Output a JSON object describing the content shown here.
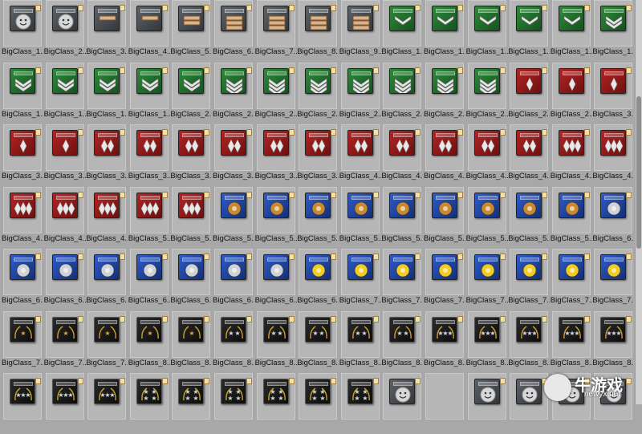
{
  "file_grid": {
    "rows": [
      {
        "items": [
          {
            "label": "BigClass_1...",
            "style": "gray-face"
          },
          {
            "label": "BigClass_2...",
            "style": "gray-face"
          },
          {
            "label": "BigClass_3...",
            "style": "gray-plank1"
          },
          {
            "label": "BigClass_4...",
            "style": "gray-plank1"
          },
          {
            "label": "BigClass_5...",
            "style": "gray-plank2"
          },
          {
            "label": "BigClass_6...",
            "style": "gray-plank3"
          },
          {
            "label": "BigClass_7...",
            "style": "gray-plank3"
          },
          {
            "label": "BigClass_8...",
            "style": "gray-plank3"
          },
          {
            "label": "BigClass_9...",
            "style": "gray-plank3"
          },
          {
            "label": "BigClass_1...",
            "style": "green-chev1"
          },
          {
            "label": "BigClass_1...",
            "style": "green-chev1"
          },
          {
            "label": "BigClass_1...",
            "style": "green-chev1"
          },
          {
            "label": "BigClass_1...",
            "style": "green-chev1"
          },
          {
            "label": "BigClass_1...",
            "style": "green-chev1"
          },
          {
            "label": "BigClass_1...",
            "style": "green-chev2"
          }
        ]
      },
      {
        "items": [
          {
            "label": "BigClass_1...",
            "style": "green-chev2"
          },
          {
            "label": "BigClass_1...",
            "style": "green-chev2"
          },
          {
            "label": "BigClass_1...",
            "style": "green-chev2"
          },
          {
            "label": "BigClass_1...",
            "style": "green-chev2"
          },
          {
            "label": "BigClass_2...",
            "style": "green-chev2"
          },
          {
            "label": "BigClass_2...",
            "style": "green-chev3"
          },
          {
            "label": "BigClass_2...",
            "style": "green-chev3"
          },
          {
            "label": "BigClass_2...",
            "style": "green-chev3"
          },
          {
            "label": "BigClass_2...",
            "style": "green-chev3"
          },
          {
            "label": "BigClass_2...",
            "style": "green-chev3"
          },
          {
            "label": "BigClass_2...",
            "style": "green-chev3"
          },
          {
            "label": "BigClass_2...",
            "style": "green-chev3"
          },
          {
            "label": "BigClass_2...",
            "style": "red-dia1"
          },
          {
            "label": "BigClass_2...",
            "style": "red-dia1"
          },
          {
            "label": "BigClass_3...",
            "style": "red-dia1"
          }
        ]
      },
      {
        "items": [
          {
            "label": "BigClass_3...",
            "style": "red-dia1"
          },
          {
            "label": "BigClass_3...",
            "style": "red-dia1"
          },
          {
            "label": "BigClass_3...",
            "style": "red-dia2"
          },
          {
            "label": "BigClass_3...",
            "style": "red-dia2"
          },
          {
            "label": "BigClass_3...",
            "style": "red-dia2"
          },
          {
            "label": "BigClass_3...",
            "style": "red-dia2"
          },
          {
            "label": "BigClass_3...",
            "style": "red-dia2"
          },
          {
            "label": "BigClass_3...",
            "style": "red-dia2"
          },
          {
            "label": "BigClass_4...",
            "style": "red-dia2"
          },
          {
            "label": "BigClass_4...",
            "style": "red-dia2"
          },
          {
            "label": "BigClass_4...",
            "style": "red-dia2"
          },
          {
            "label": "BigClass_4...",
            "style": "red-dia2"
          },
          {
            "label": "BigClass_4...",
            "style": "red-dia2"
          },
          {
            "label": "BigClass_4...",
            "style": "red-dia3"
          },
          {
            "label": "BigClass_4...",
            "style": "red-dia3"
          }
        ]
      },
      {
        "items": [
          {
            "label": "BigClass_4...",
            "style": "red-dia3"
          },
          {
            "label": "BigClass_4...",
            "style": "red-dia3"
          },
          {
            "label": "BigClass_4...",
            "style": "red-dia3"
          },
          {
            "label": "BigClass_5...",
            "style": "red-dia3"
          },
          {
            "label": "BigClass_5...",
            "style": "red-dia3"
          },
          {
            "label": "BigClass_5...",
            "style": "blue-gold"
          },
          {
            "label": "BigClass_5...",
            "style": "blue-gold"
          },
          {
            "label": "BigClass_5...",
            "style": "blue-gold"
          },
          {
            "label": "BigClass_5...",
            "style": "blue-gold"
          },
          {
            "label": "BigClass_5...",
            "style": "blue-gold"
          },
          {
            "label": "BigClass_5...",
            "style": "blue-gold"
          },
          {
            "label": "BigClass_5...",
            "style": "blue-gold"
          },
          {
            "label": "BigClass_5...",
            "style": "blue-gold"
          },
          {
            "label": "BigClass_5...",
            "style": "blue-gold"
          },
          {
            "label": "BigClass_6...",
            "style": "blue-silver"
          }
        ]
      },
      {
        "items": [
          {
            "label": "BigClass_6...",
            "style": "blue-silver"
          },
          {
            "label": "BigClass_6...",
            "style": "blue-silver"
          },
          {
            "label": "BigClass_6...",
            "style": "blue-silver"
          },
          {
            "label": "BigClass_6...",
            "style": "blue-silver"
          },
          {
            "label": "BigClass_6...",
            "style": "blue-silver"
          },
          {
            "label": "BigClass_6...",
            "style": "blue-silver"
          },
          {
            "label": "BigClass_6...",
            "style": "blue-silver"
          },
          {
            "label": "BigClass_6...",
            "style": "blue-yellow"
          },
          {
            "label": "BigClass_7...",
            "style": "blue-yellow"
          },
          {
            "label": "BigClass_7...",
            "style": "blue-yellow"
          },
          {
            "label": "BigClass_7...",
            "style": "blue-yellow"
          },
          {
            "label": "BigClass_7...",
            "style": "blue-yellow"
          },
          {
            "label": "BigClass_7...",
            "style": "blue-yellow"
          },
          {
            "label": "BigClass_7...",
            "style": "blue-yellow"
          },
          {
            "label": "BigClass_7...",
            "style": "blue-yellow"
          }
        ]
      },
      {
        "items": [
          {
            "label": "BigClass_7...",
            "style": "black-star1"
          },
          {
            "label": "BigClass_7...",
            "style": "black-star1"
          },
          {
            "label": "BigClass_7...",
            "style": "black-star1"
          },
          {
            "label": "BigClass_8...",
            "style": "black-star1"
          },
          {
            "label": "BigClass_8...",
            "style": "black-star1"
          },
          {
            "label": "BigClass_8...",
            "style": "black-star2"
          },
          {
            "label": "BigClass_8...",
            "style": "black-star2"
          },
          {
            "label": "BigClass_8...",
            "style": "black-star2"
          },
          {
            "label": "BigClass_8...",
            "style": "black-star2"
          },
          {
            "label": "BigClass_8...",
            "style": "black-star2"
          },
          {
            "label": "BigClass_8...",
            "style": "black-star3"
          },
          {
            "label": "BigClass_8...",
            "style": "black-star3"
          },
          {
            "label": "BigClass_8...",
            "style": "black-star3"
          },
          {
            "label": "BigClass_8...",
            "style": "black-star3"
          },
          {
            "label": "BigClass_8...",
            "style": "black-star3"
          }
        ]
      },
      {
        "items": [
          {
            "label": "",
            "style": "black-star3"
          },
          {
            "label": "",
            "style": "black-star3"
          },
          {
            "label": "",
            "style": "black-star3"
          },
          {
            "label": "",
            "style": "black-star4"
          },
          {
            "label": "",
            "style": "black-star4"
          },
          {
            "label": "",
            "style": "black-star4"
          },
          {
            "label": "",
            "style": "black-star4"
          },
          {
            "label": "",
            "style": "black-star4"
          },
          {
            "label": "",
            "style": "black-star4"
          },
          {
            "label": "",
            "style": "gray-face"
          },
          {
            "label": "",
            "style": "empty"
          },
          {
            "label": "",
            "style": "gray-face"
          },
          {
            "label": "",
            "style": "gray-face"
          },
          {
            "label": "",
            "style": "gray-face"
          },
          {
            "label": "",
            "style": "gray-face"
          }
        ]
      }
    ]
  },
  "watermark": {
    "brand": "牛游戏",
    "url": "newyx.net"
  },
  "colors": {
    "background": "#a8a8a8",
    "green": "#1f6e2a",
    "red": "#9b1b1b",
    "blue": "#1c3f9e",
    "black": "#1a1a1a",
    "gray": "#4b5055"
  }
}
